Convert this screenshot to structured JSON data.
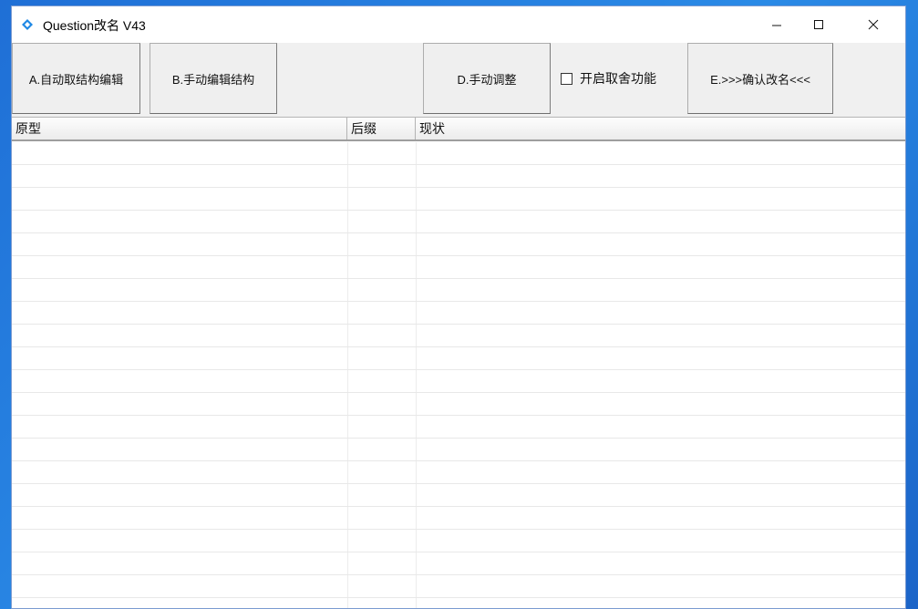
{
  "window": {
    "title": "Question改名 V43",
    "icon": "app-diamond-icon",
    "controls": [
      "minimize-icon",
      "maximize-icon",
      "close-icon"
    ]
  },
  "toolbar": {
    "btn_a": "A.自动取结构编辑",
    "btn_b": "B.手动编辑结构",
    "btn_d": "D.手动调整",
    "checkbox_label": "开启取舍功能",
    "checkbox_checked": false,
    "btn_e": "E.>>>确认改名<<<"
  },
  "table": {
    "columns": [
      "原型",
      "后缀",
      "现状"
    ],
    "rows": []
  },
  "colors": {
    "desktop": "#1f6fd6",
    "window_bg": "#f0f0f0",
    "accent_icon": "#1e88e5"
  }
}
